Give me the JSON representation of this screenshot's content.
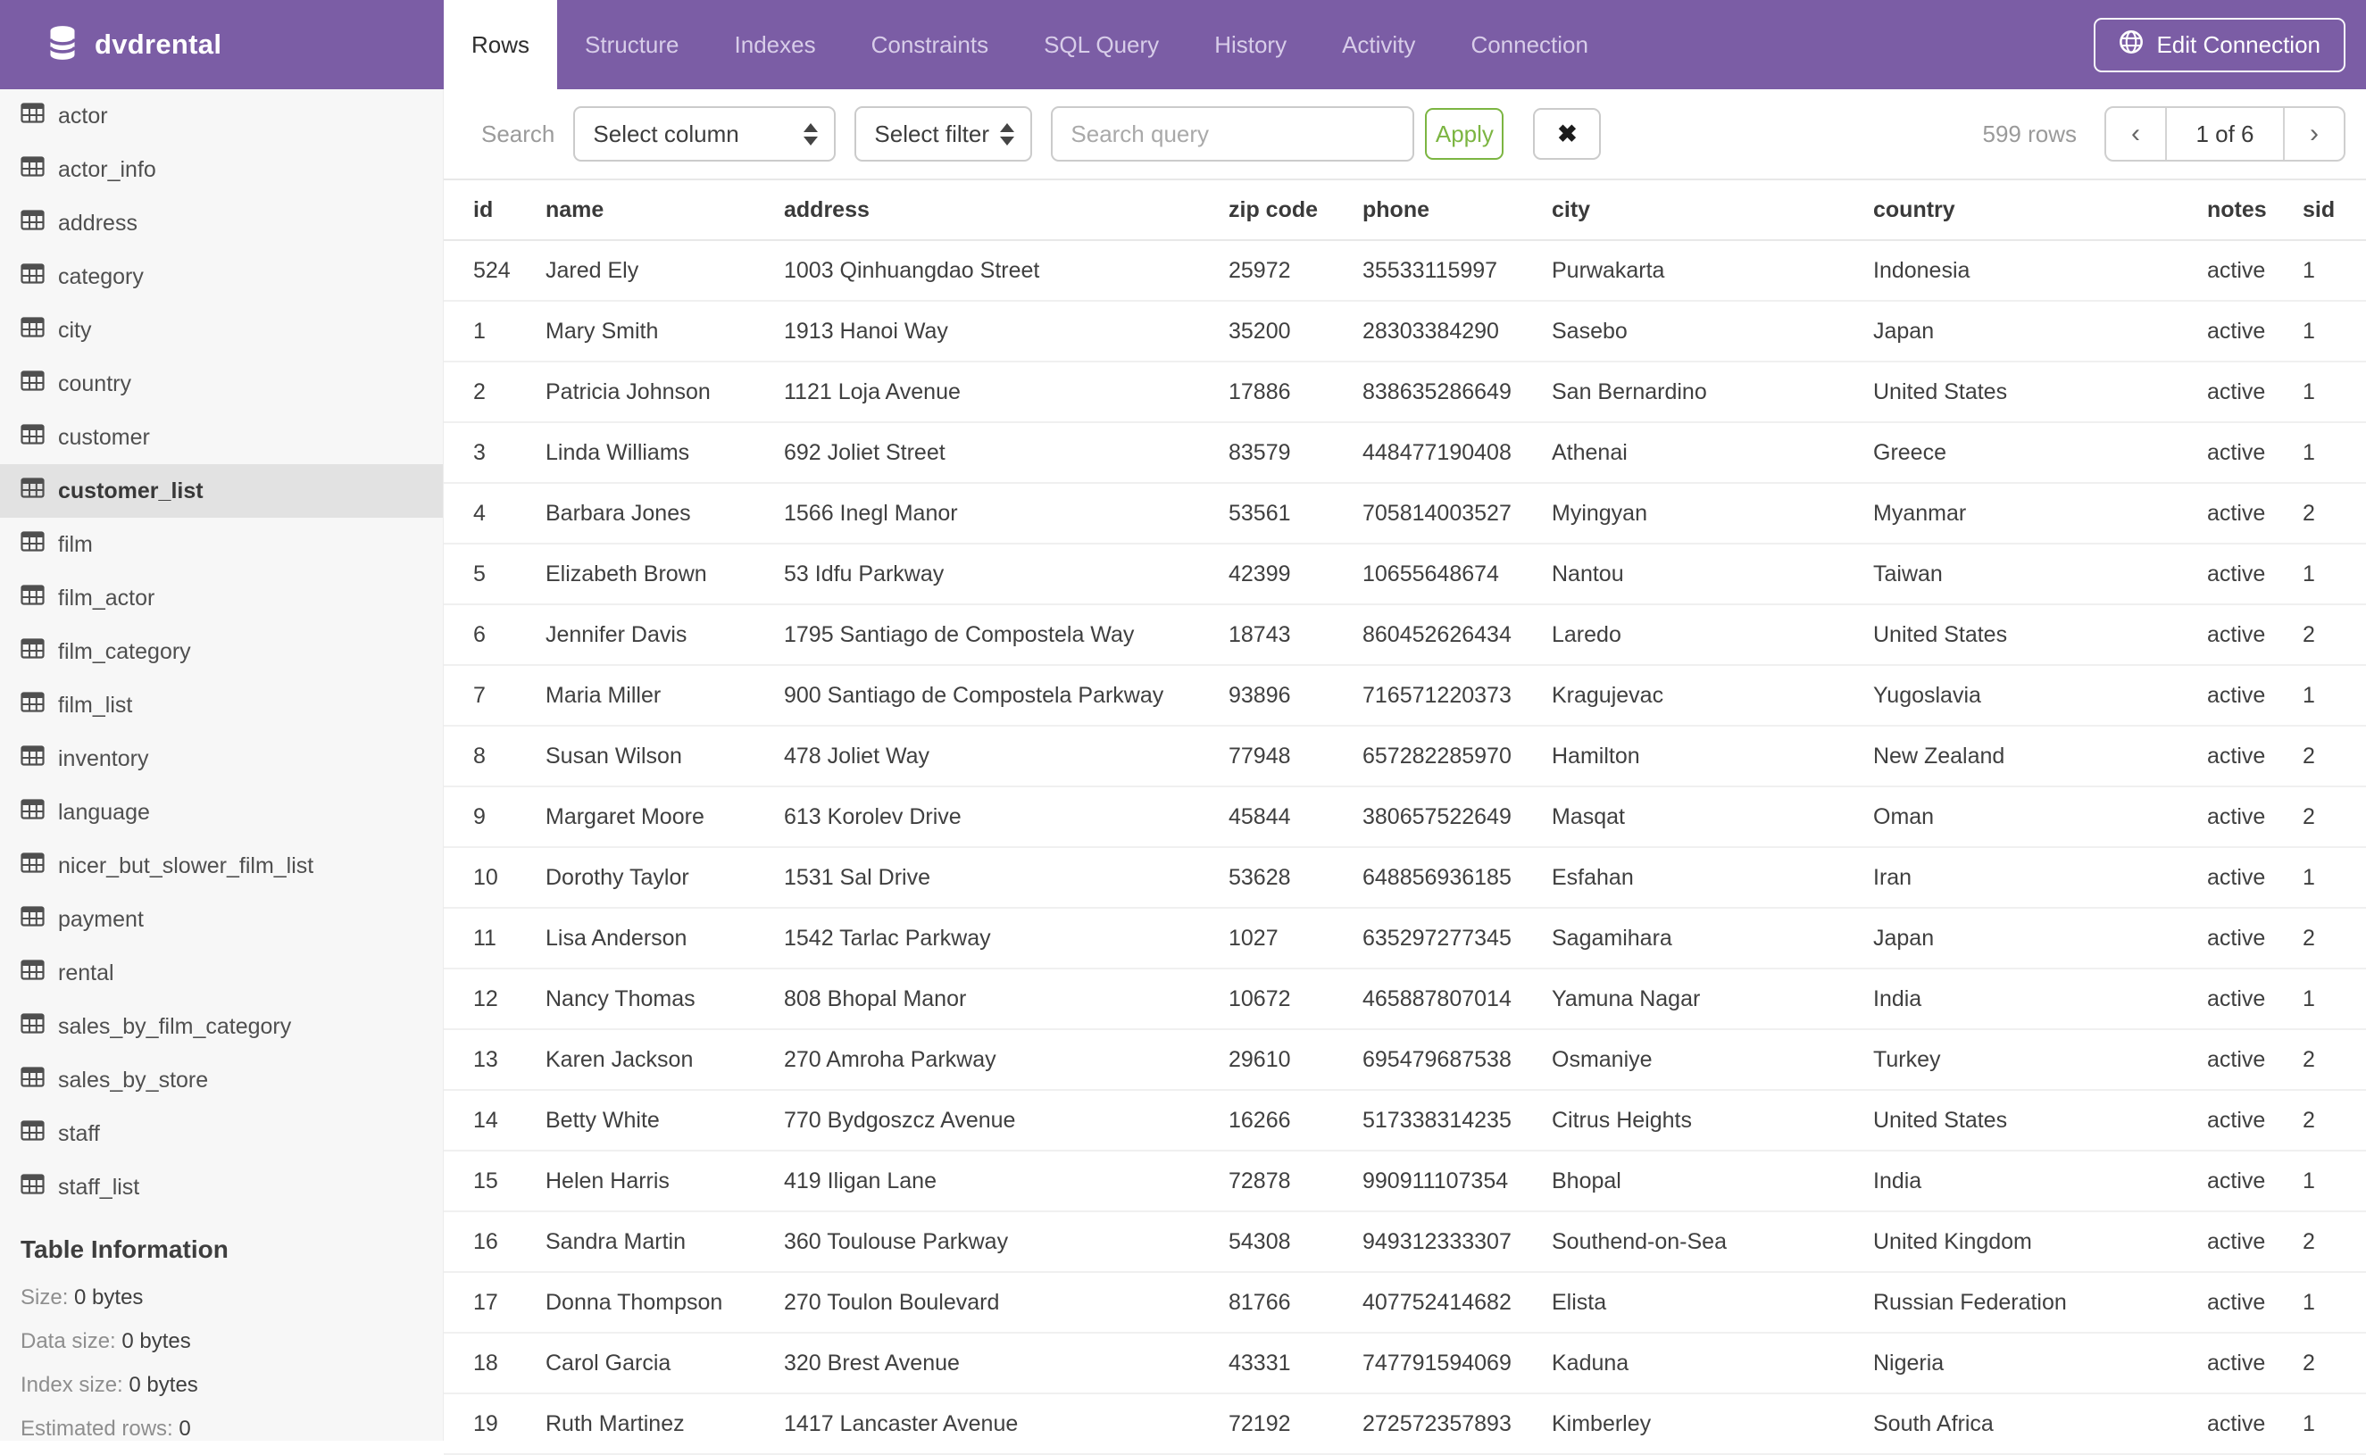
{
  "header": {
    "database_name": "dvdrental",
    "tabs": [
      {
        "label": "Rows",
        "active": true
      },
      {
        "label": "Structure",
        "active": false
      },
      {
        "label": "Indexes",
        "active": false
      },
      {
        "label": "Constraints",
        "active": false
      },
      {
        "label": "SQL Query",
        "active": false
      },
      {
        "label": "History",
        "active": false
      },
      {
        "label": "Activity",
        "active": false
      },
      {
        "label": "Connection",
        "active": false
      }
    ],
    "edit_connection_label": "Edit Connection"
  },
  "sidebar": {
    "tables": [
      "actor",
      "actor_info",
      "address",
      "category",
      "city",
      "country",
      "customer",
      "customer_list",
      "film",
      "film_actor",
      "film_category",
      "film_list",
      "inventory",
      "language",
      "nicer_but_slower_film_list",
      "payment",
      "rental",
      "sales_by_film_category",
      "sales_by_store",
      "staff",
      "staff_list"
    ],
    "selected_table": "customer_list",
    "table_information": {
      "title": "Table Information",
      "rows": [
        {
          "label": "Size:",
          "value": "0 bytes"
        },
        {
          "label": "Data size:",
          "value": "0 bytes"
        },
        {
          "label": "Index size:",
          "value": "0 bytes"
        },
        {
          "label": "Estimated rows:",
          "value": "0"
        }
      ]
    }
  },
  "toolbar": {
    "search_label": "Search",
    "column_select_value": "Select column",
    "filter_select_value": "Select filter",
    "query_placeholder": "Search query",
    "apply_label": "Apply",
    "clear_label": "✖",
    "row_count": "599 rows",
    "pagination": {
      "prev": "‹",
      "current": "1 of 6",
      "next": "›"
    }
  },
  "table": {
    "columns": [
      "id",
      "name",
      "address",
      "zip code",
      "phone",
      "city",
      "country",
      "notes",
      "sid"
    ],
    "rows": [
      [
        "524",
        "Jared Ely",
        "1003 Qinhuangdao Street",
        "25972",
        "35533115997",
        "Purwakarta",
        "Indonesia",
        "active",
        "1"
      ],
      [
        "1",
        "Mary Smith",
        "1913 Hanoi Way",
        "35200",
        "28303384290",
        "Sasebo",
        "Japan",
        "active",
        "1"
      ],
      [
        "2",
        "Patricia Johnson",
        "1121 Loja Avenue",
        "17886",
        "838635286649",
        "San Bernardino",
        "United States",
        "active",
        "1"
      ],
      [
        "3",
        "Linda Williams",
        "692 Joliet Street",
        "83579",
        "448477190408",
        "Athenai",
        "Greece",
        "active",
        "1"
      ],
      [
        "4",
        "Barbara Jones",
        "1566 Inegl Manor",
        "53561",
        "705814003527",
        "Myingyan",
        "Myanmar",
        "active",
        "2"
      ],
      [
        "5",
        "Elizabeth Brown",
        "53 Idfu Parkway",
        "42399",
        "10655648674",
        "Nantou",
        "Taiwan",
        "active",
        "1"
      ],
      [
        "6",
        "Jennifer Davis",
        "1795 Santiago de Compostela Way",
        "18743",
        "860452626434",
        "Laredo",
        "United States",
        "active",
        "2"
      ],
      [
        "7",
        "Maria Miller",
        "900 Santiago de Compostela Parkway",
        "93896",
        "716571220373",
        "Kragujevac",
        "Yugoslavia",
        "active",
        "1"
      ],
      [
        "8",
        "Susan Wilson",
        "478 Joliet Way",
        "77948",
        "657282285970",
        "Hamilton",
        "New Zealand",
        "active",
        "2"
      ],
      [
        "9",
        "Margaret Moore",
        "613 Korolev Drive",
        "45844",
        "380657522649",
        "Masqat",
        "Oman",
        "active",
        "2"
      ],
      [
        "10",
        "Dorothy Taylor",
        "1531 Sal Drive",
        "53628",
        "648856936185",
        "Esfahan",
        "Iran",
        "active",
        "1"
      ],
      [
        "11",
        "Lisa Anderson",
        "1542 Tarlac Parkway",
        "1027",
        "635297277345",
        "Sagamihara",
        "Japan",
        "active",
        "2"
      ],
      [
        "12",
        "Nancy Thomas",
        "808 Bhopal Manor",
        "10672",
        "465887807014",
        "Yamuna Nagar",
        "India",
        "active",
        "1"
      ],
      [
        "13",
        "Karen Jackson",
        "270 Amroha Parkway",
        "29610",
        "695479687538",
        "Osmaniye",
        "Turkey",
        "active",
        "2"
      ],
      [
        "14",
        "Betty White",
        "770 Bydgoszcz Avenue",
        "16266",
        "517338314235",
        "Citrus Heights",
        "United States",
        "active",
        "2"
      ],
      [
        "15",
        "Helen Harris",
        "419 Iligan Lane",
        "72878",
        "990911107354",
        "Bhopal",
        "India",
        "active",
        "1"
      ],
      [
        "16",
        "Sandra Martin",
        "360 Toulouse Parkway",
        "54308",
        "949312333307",
        "Southend-on-Sea",
        "United Kingdom",
        "active",
        "2"
      ],
      [
        "17",
        "Donna Thompson",
        "270 Toulon Boulevard",
        "81766",
        "407752414682",
        "Elista",
        "Russian Federation",
        "active",
        "1"
      ],
      [
        "18",
        "Carol Garcia",
        "320 Brest Avenue",
        "43331",
        "747791594069",
        "Kaduna",
        "Nigeria",
        "active",
        "2"
      ],
      [
        "19",
        "Ruth Martinez",
        "1417 Lancaster Avenue",
        "72192",
        "272572357893",
        "Kimberley",
        "South Africa",
        "active",
        "1"
      ]
    ]
  },
  "colors": {
    "header_purple": "#7B5DA5",
    "inactive_tab_text": "#D8CDE9",
    "apply_green": "#7CB542",
    "sidebar_bg": "#F7F7F7",
    "selected_item_bg": "#E2E2E2"
  }
}
